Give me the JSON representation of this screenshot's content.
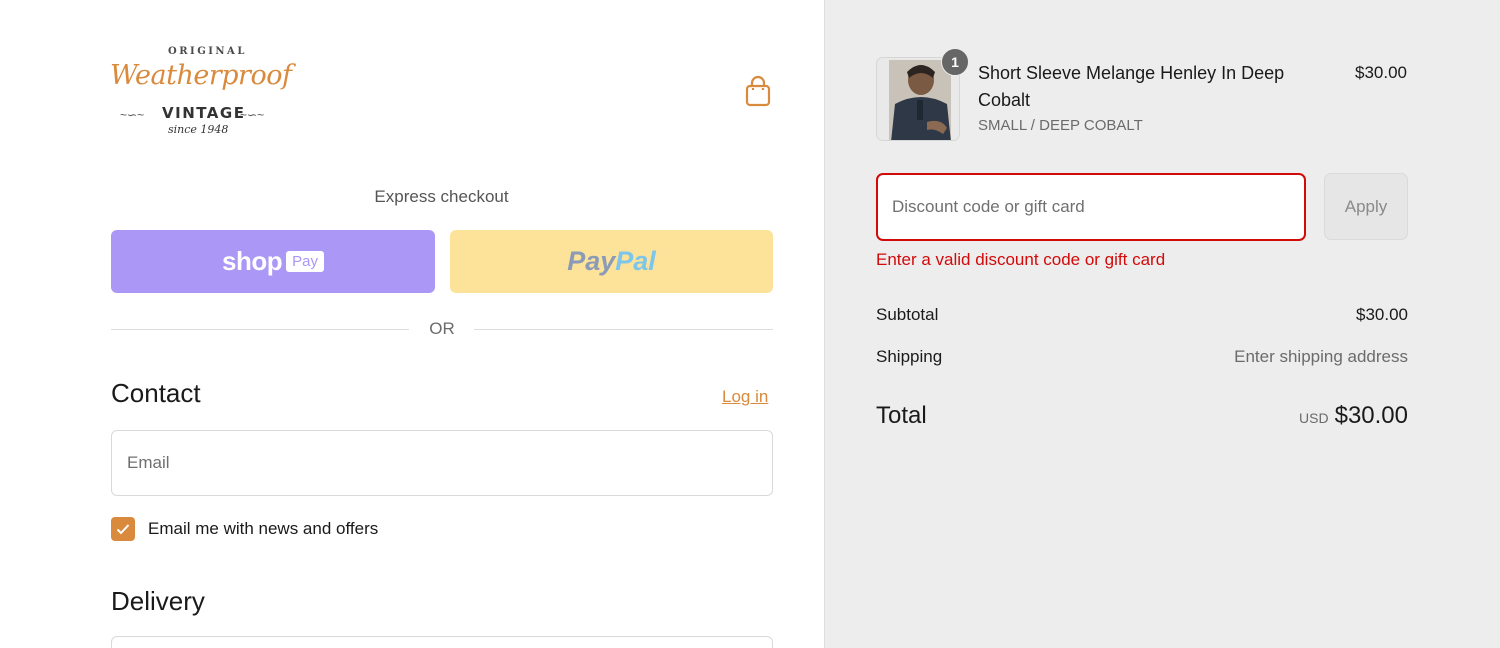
{
  "brand": {
    "line1": "ORIGINAL",
    "script": "Weatherproof",
    "line2": "VINTAGE",
    "line3": "since 1948"
  },
  "header": {
    "cart_icon": "shopping-bag-icon"
  },
  "express": {
    "title": "Express checkout",
    "shop_pay": {
      "shop": "shop",
      "pay": "Pay"
    },
    "paypal": {
      "part1": "Pay",
      "part2": "Pal"
    },
    "separator": "OR"
  },
  "contact": {
    "heading": "Contact",
    "login_link": "Log in",
    "email_placeholder": "Email",
    "newsletter_label": "Email me with news and offers",
    "newsletter_checked": true
  },
  "delivery": {
    "heading": "Delivery"
  },
  "cart": {
    "item": {
      "quantity": "1",
      "name": "Short Sleeve Melange Henley In Deep Cobalt",
      "variant": "SMALL / DEEP COBALT",
      "price": "$30.00"
    },
    "discount": {
      "placeholder": "Discount code or gift card",
      "apply_label": "Apply",
      "error": "Enter a valid discount code or gift card"
    },
    "subtotal": {
      "label": "Subtotal",
      "value": "$30.00"
    },
    "shipping": {
      "label": "Shipping",
      "value": "Enter shipping address"
    },
    "total": {
      "label": "Total",
      "currency": "USD",
      "value": "$30.00"
    }
  },
  "colors": {
    "accent": "#d98a3d",
    "shop_pay": "#ab97f5",
    "paypal": "#fde29a",
    "error": "#d20a0a",
    "summary_bg": "#ededed"
  }
}
